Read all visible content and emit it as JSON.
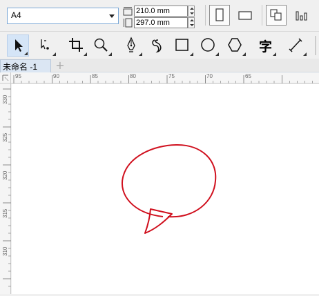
{
  "property_bar": {
    "paper_size": "A4",
    "width_value": "210.0 mm",
    "height_value": "297.0 mm"
  },
  "document": {
    "tab_title": "未命名 -1",
    "add_tab_glyph": "+"
  },
  "toolbox": {
    "text_tool_glyph": "字"
  },
  "ruler": {
    "horizontal": [
      "95",
      "90",
      "85",
      "80",
      "75",
      "70",
      "65"
    ],
    "vertical": [
      "330",
      "325",
      "320",
      "315",
      "310"
    ]
  },
  "colors": {
    "shape_outline": "#d0101e",
    "active_tool_bg": "#d5e5f7"
  },
  "icons": [
    "portrait-icon",
    "landscape-icon",
    "all-pages-icon",
    "current-page-icon",
    "pick-tool-icon",
    "shape-tool-icon",
    "crop-tool-icon",
    "zoom-tool-icon",
    "pen-tool-icon",
    "artistic-media-icon",
    "rectangle-tool-icon",
    "ellipse-tool-icon",
    "polygon-tool-icon",
    "text-tool-icon",
    "dimension-tool-icon"
  ]
}
